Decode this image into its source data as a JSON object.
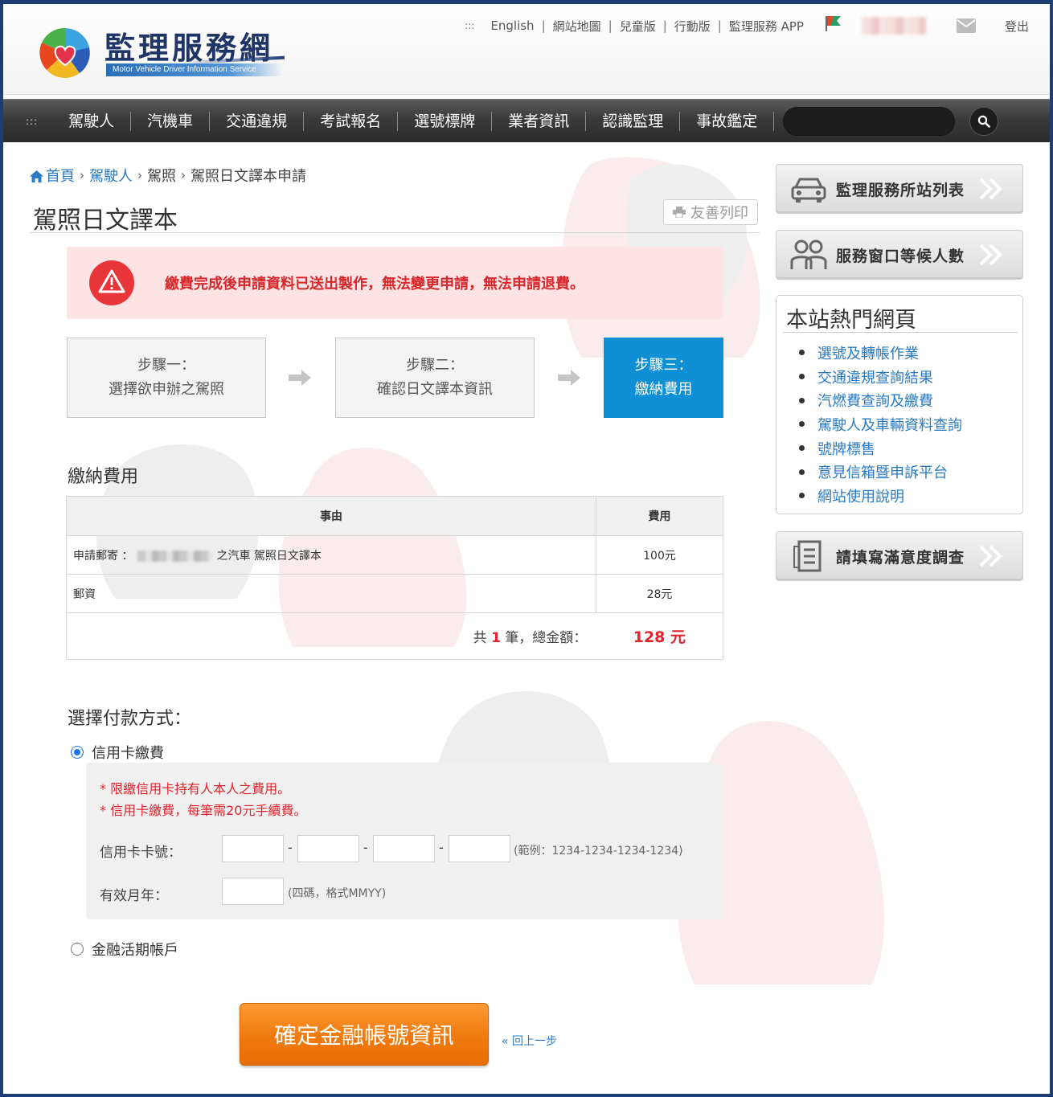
{
  "header": {
    "logo_title": "監理服務網",
    "logo_subtitle": "Motor Vehicle Driver Information Service",
    "util_links": [
      "English",
      "網站地圖",
      "兒童版",
      "行動版",
      "監理服務 APP"
    ],
    "logout": "登出",
    "dots": ":::"
  },
  "nav": {
    "dots": ":::",
    "items": [
      "駕駛人",
      "汽機車",
      "交通違規",
      "考試報名",
      "選號標牌",
      "業者資訊",
      "認識監理",
      "事故鑑定"
    ],
    "search_placeholder": ""
  },
  "breadcrumb": {
    "home": "首頁",
    "driver": "駕駛人",
    "license": "駕照",
    "current": "駕照日文譯本申請"
  },
  "page": {
    "title": "駕照日文譯本",
    "print": "友善列印"
  },
  "alert": {
    "text": "繳費完成後申請資料已送出製作，無法變更申請，無法申請退費。"
  },
  "steps": [
    {
      "line1": "步驟一：",
      "line2": "選擇欲申辦之駕照"
    },
    {
      "line1": "步驟二：",
      "line2": "確認日文譯本資訊"
    },
    {
      "line1": "步驟三：",
      "line2": "繳納費用"
    }
  ],
  "fees": {
    "section_title": "繳納費用",
    "col_reason": "事由",
    "col_fee": "費用",
    "row1_prefix": "申請郵寄 ：",
    "row1_suffix": "之汽車 駕照日文譯本",
    "row1_amount": "100元",
    "row2_desc": "郵資",
    "row2_amount": "28元",
    "total_prefix": "共",
    "total_count": "1",
    "total_mid": "筆，總金額：",
    "total_amount": "128 元"
  },
  "payment": {
    "title": "選擇付款方式：",
    "credit_card": "信用卡繳費",
    "note1": "* 限繳信用卡持有人本人之費用。",
    "note2": "* 信用卡繳費，每筆需20元手續費。",
    "card_label": "信用卡卡號：",
    "card_hint": "(範例：1234-1234-1234-1234)",
    "expiry_label": "有效月年：",
    "expiry_hint": "(四碼，格式MMYY)",
    "bank": "金融活期帳戶",
    "confirm": "確定金融帳號資訊",
    "back": "« 回上一步",
    "dash": "-"
  },
  "sidebar": {
    "station_list": "監理服務所站列表",
    "queue": "服務窗口等候人數",
    "hot_title": "本站熱門網頁",
    "hot_links": [
      "選號及轉帳作業",
      "交通違規查詢結果",
      "汽燃費查詢及繳費",
      "駕駛人及車輛資料查詢",
      "號牌標售",
      "意見信箱暨申訴平台",
      "網站使用說明"
    ],
    "survey": "請填寫滿意度調查"
  },
  "colors": {
    "accent_blue": "#0f8fd6",
    "alert_red": "#d7272b",
    "orange": "#f07a0d",
    "link": "#2a7ac3"
  }
}
